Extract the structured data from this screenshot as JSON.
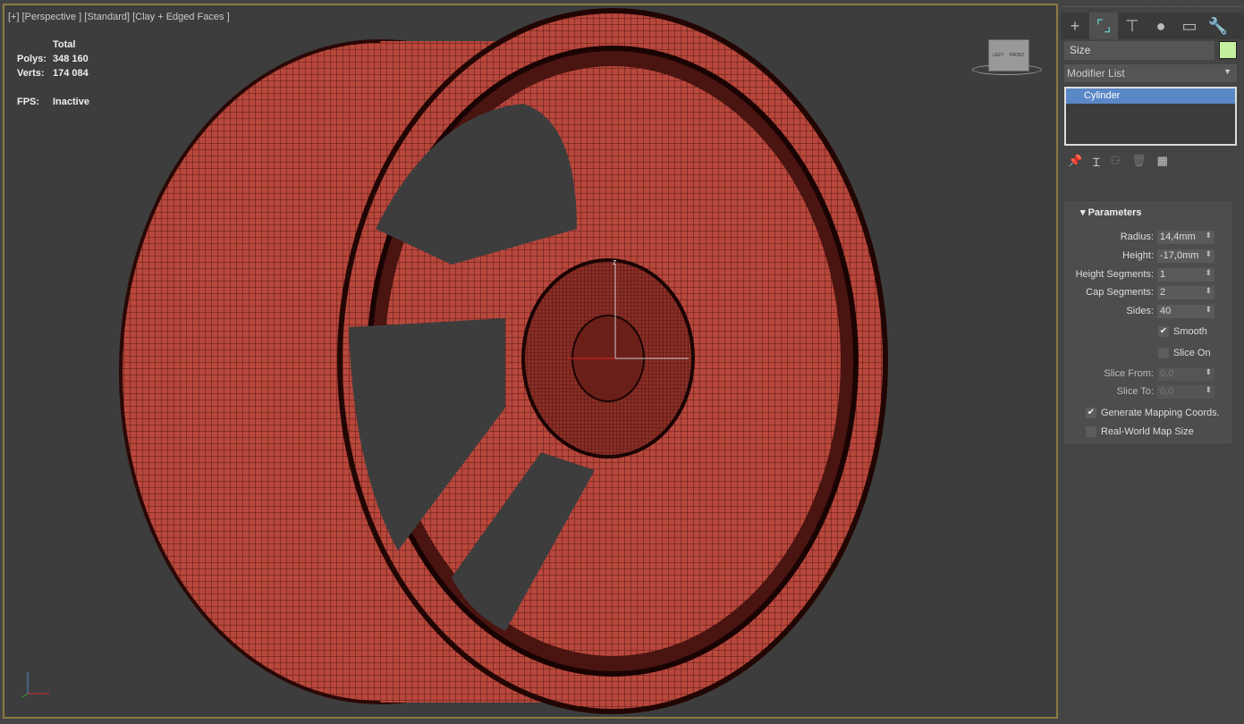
{
  "viewport": {
    "label": "[+] [Perspective ] [Standard] [Clay + Edged Faces ]",
    "stats": {
      "total_label": "Total",
      "polys_label": "Polys:",
      "polys": "348 160",
      "verts_label": "Verts:",
      "verts": "174 084",
      "fps_label": "FPS:",
      "fps": "Inactive"
    },
    "viewcube": {
      "left": "LEFT",
      "front": "FRONT"
    },
    "gizmo": {
      "z": "z"
    },
    "model_color": "#b8473c"
  },
  "panel": {
    "tabs": [
      {
        "icon": "create-icon"
      },
      {
        "icon": "modify-icon",
        "active": true
      },
      {
        "icon": "hierarchy-icon"
      },
      {
        "icon": "motion-icon"
      },
      {
        "icon": "display-icon"
      },
      {
        "icon": "utilities-icon"
      }
    ],
    "name": "Size",
    "object_color": "#c4f0a0",
    "modifier_list": "Modifier List",
    "stack": [
      "Cylinder"
    ],
    "parameters": {
      "title": "Parameters",
      "radius_label": "Radius:",
      "radius": "14,4mm",
      "height_label": "Height:",
      "height": "-17,0mm",
      "hseg_label": "Height Segments:",
      "hseg": "1",
      "cseg_label": "Cap Segments:",
      "cseg": "2",
      "sides_label": "Sides:",
      "sides": "40",
      "smooth": "Smooth",
      "smooth_checked": true,
      "slice_on": "Slice On",
      "slice_on_checked": false,
      "slice_from_label": "Slice From:",
      "slice_from": "0,0",
      "slice_to_label": "Slice To:",
      "slice_to": "0,0",
      "gen_map": "Generate Mapping Coords.",
      "gen_map_checked": true,
      "real_world": "Real-World Map Size",
      "real_world_checked": false
    }
  }
}
